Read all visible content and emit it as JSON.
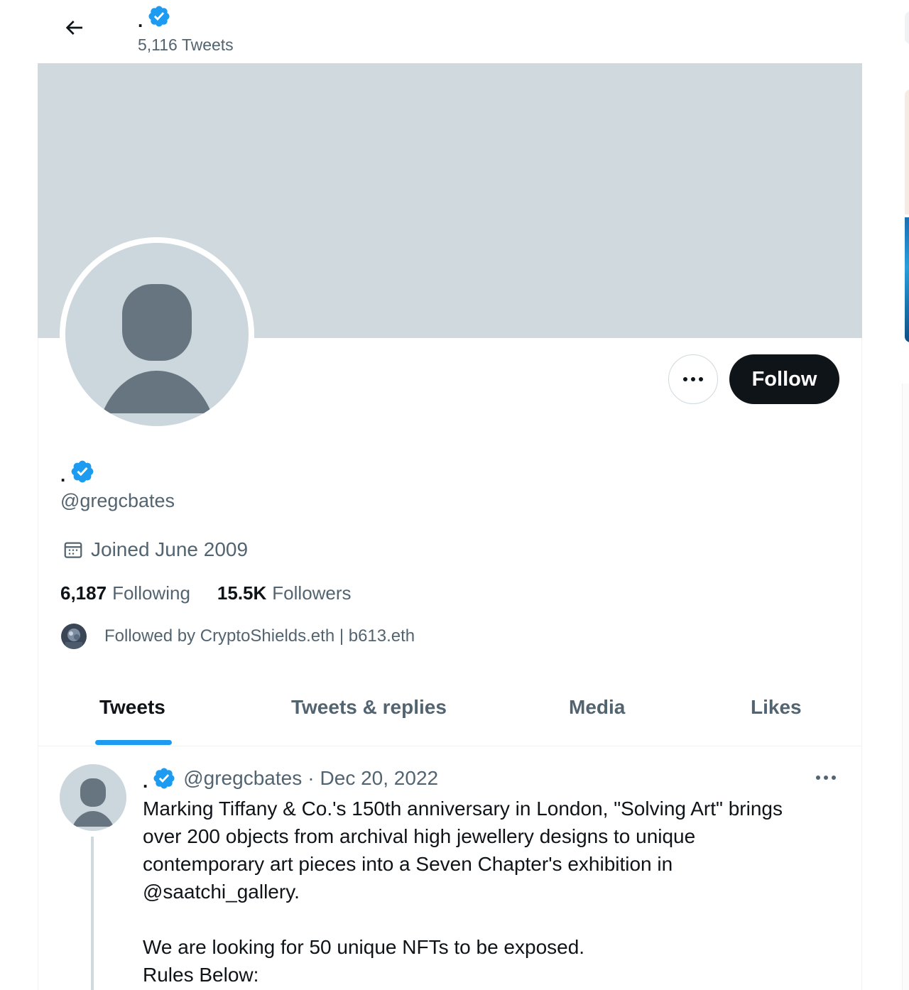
{
  "header": {
    "display_name": ".",
    "tweet_count_label": "5,116 Tweets"
  },
  "profile": {
    "display_name": ".",
    "handle": "@gregcbates",
    "joined": "Joined June 2009",
    "following_count": "6,187",
    "following_label": "Following",
    "followers_count": "15.5K",
    "followers_label": "Followers",
    "followed_by": "Followed by CryptoShields.eth | b613.eth"
  },
  "actions": {
    "follow_label": "Follow"
  },
  "tabs": [
    {
      "label": "Tweets",
      "active": true
    },
    {
      "label": "Tweets & replies",
      "active": false
    },
    {
      "label": "Media",
      "active": false
    },
    {
      "label": "Likes",
      "active": false
    }
  ],
  "tweet": {
    "display_name": ".",
    "handle": "@gregcbates",
    "separator": "·",
    "date": "Dec 20, 2022",
    "text_line1": "Marking Tiffany & Co.'s 150th anniversary in London, \"Solving Art\" brings",
    "text_line2": "over 200 objects from archival high jewellery designs to unique",
    "text_line3": "contemporary art pieces into a Seven Chapter's exhibition in",
    "text_line4": "@saatchi_gallery.",
    "text_line5": "We are looking for 50 unique NFTs to be exposed.",
    "text_line6": "Rules Below:"
  },
  "icons": {
    "back": "arrow-left-icon",
    "verified": "verified-badge-icon",
    "more": "more-horizontal-icon",
    "calendar": "calendar-icon"
  },
  "colors": {
    "accent": "#1d9bf0",
    "banner": "#cfd9de",
    "text_primary": "#0f1419",
    "text_secondary": "#536471",
    "follow_button": "#0f1419"
  }
}
